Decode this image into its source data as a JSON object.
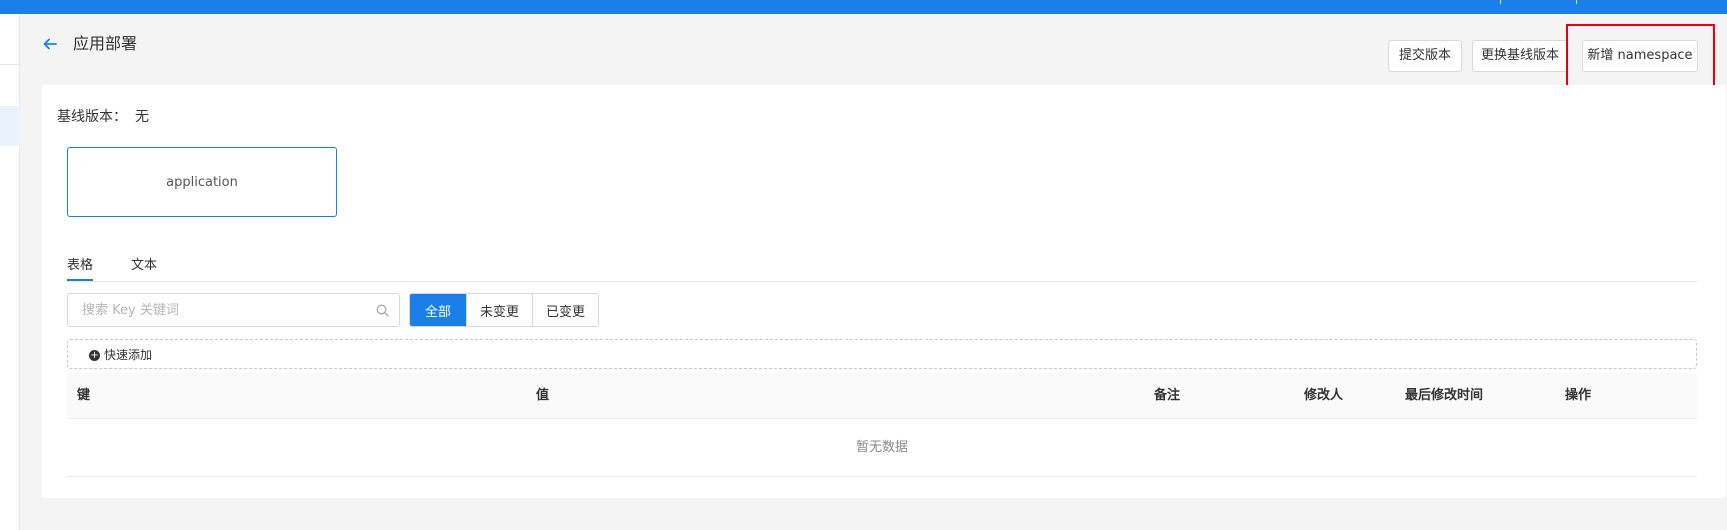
{
  "header": {
    "title": "应用部署",
    "buttons": {
      "submit": "提交版本",
      "switch_baseline": "更换基线版本",
      "add_namespace": "新增 namespace"
    }
  },
  "baseline": {
    "label": "基线版本：",
    "value": "无"
  },
  "namespaces": [
    "application"
  ],
  "tabs": {
    "table": "表格",
    "text": "文本",
    "active": "table"
  },
  "search": {
    "placeholder": "搜索 Key 关键词",
    "value": ""
  },
  "filter": {
    "all": "全部",
    "unchanged": "未变更",
    "changed": "已变更",
    "selected": "all"
  },
  "quick_add": "快速添加",
  "table": {
    "columns": {
      "key": "键",
      "value": "值",
      "remark": "备注",
      "modifier": "修改人",
      "modified_time": "最后修改时间",
      "operation": "操作"
    },
    "rows": [],
    "empty_text": "暂无数据"
  },
  "colors": {
    "accent": "#1a7fe8",
    "highlight": "#e60012"
  },
  "icons": {
    "back": "arrow-left-icon",
    "search": "search-icon",
    "quick_add": "plus-circle-icon"
  }
}
